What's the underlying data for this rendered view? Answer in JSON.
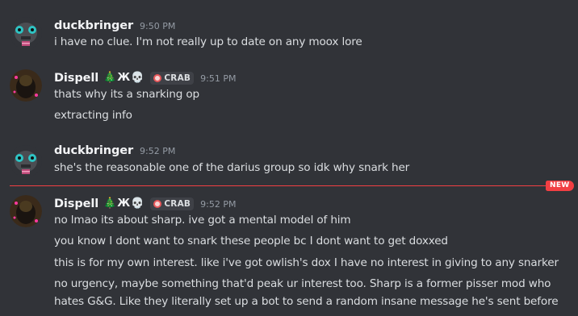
{
  "messages": [
    {
      "username": "duckbringer",
      "time": "9:50 PM",
      "lines": [
        "i have no clue. I'm not really up to date on any moox lore"
      ]
    },
    {
      "username": "Dispell",
      "badges": [
        "🎄",
        "Ж",
        "💀"
      ],
      "tag": "CRAB",
      "time": "9:51 PM",
      "lines": [
        "thats why its a snarking op",
        "extracting info"
      ]
    },
    {
      "username": "duckbringer",
      "time": "9:52 PM",
      "lines": [
        "she's the reasonable one of the darius group so idk why snark her"
      ]
    },
    {
      "username": "Dispell",
      "badges": [
        "🎄",
        "Ж",
        "💀"
      ],
      "tag": "CRAB",
      "time": "9:52 PM",
      "lines": [
        "no lmao its about sharp. ive got a mental model of him",
        "you know I dont want to snark these people bc I dont want to get doxxed",
        "this is for my own interest. like i've got owlish's dox I have no interest in giving to any snarker",
        "no urgency, maybe something that'd peak ur interest too. Sharp is a former pisser mod who",
        "hates G&G. Like they literally set up a bot to send a random insane message he's sent before"
      ]
    }
  ],
  "new_divider": {
    "label": "NEW"
  },
  "colors": {
    "background": "#313338",
    "new_marker": "#f23f43",
    "text": "#dbdee1",
    "username": "#f2f3f5",
    "timestamp": "#949ba4"
  }
}
